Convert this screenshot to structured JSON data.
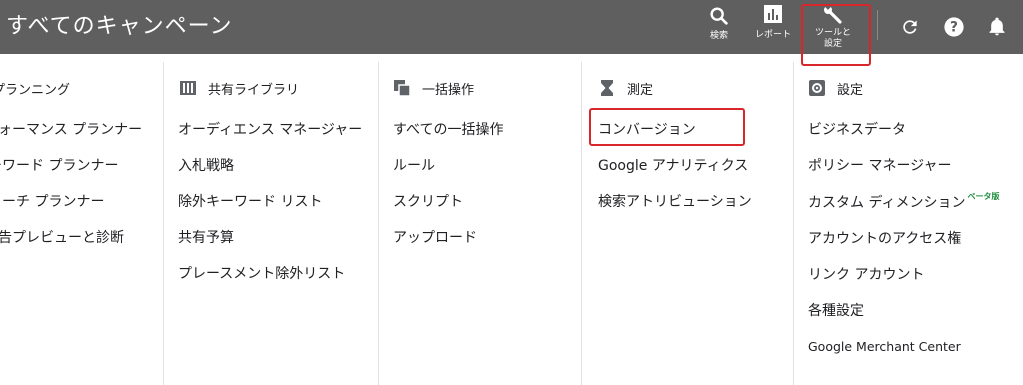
{
  "header": {
    "title": "すべてのキャンペーン",
    "actions": [
      {
        "id": "search",
        "label": "検索",
        "icon": "search-icon"
      },
      {
        "id": "report",
        "label": "レポート",
        "icon": "bar-chart-icon"
      },
      {
        "id": "tools",
        "label_line1": "ツールと",
        "label_line2": "設定",
        "icon": "wrench-icon"
      },
      {
        "id": "refresh",
        "icon": "refresh-icon"
      },
      {
        "id": "help",
        "icon": "help-icon"
      },
      {
        "id": "notifications",
        "icon": "bell-icon"
      }
    ]
  },
  "columns": {
    "planning": {
      "title": "プランニング",
      "items": [
        "パフォーマンス プランナー",
        "キーワード プランナー",
        "リーチ プランナー",
        "広告プレビューと診断"
      ]
    },
    "shared_library": {
      "title": "共有ライブラリ",
      "items": [
        "オーディエンス マネージャー",
        "入札戦略",
        "除外キーワード リスト",
        "共有予算",
        "プレースメント除外リスト"
      ]
    },
    "bulk_actions": {
      "title": "一括操作",
      "items": [
        "すべての一括操作",
        "ルール",
        "スクリプト",
        "アップロード"
      ]
    },
    "measurement": {
      "title": "測定",
      "items": [
        "コンバージョン",
        "Google アナリティクス",
        "検索アトリビューション"
      ]
    },
    "setup": {
      "title": "設定",
      "items": [
        "ビジネスデータ",
        "ポリシー マネージャー",
        "カスタム ディメンション",
        "アカウントのアクセス権",
        "リンク アカウント",
        "各種設定",
        "Google Merchant Center"
      ],
      "beta_label": "ベータ版"
    }
  },
  "colors": {
    "header_bg": "#5f5f5f",
    "highlight": "#d9262a",
    "beta": "#1e8e3e"
  }
}
